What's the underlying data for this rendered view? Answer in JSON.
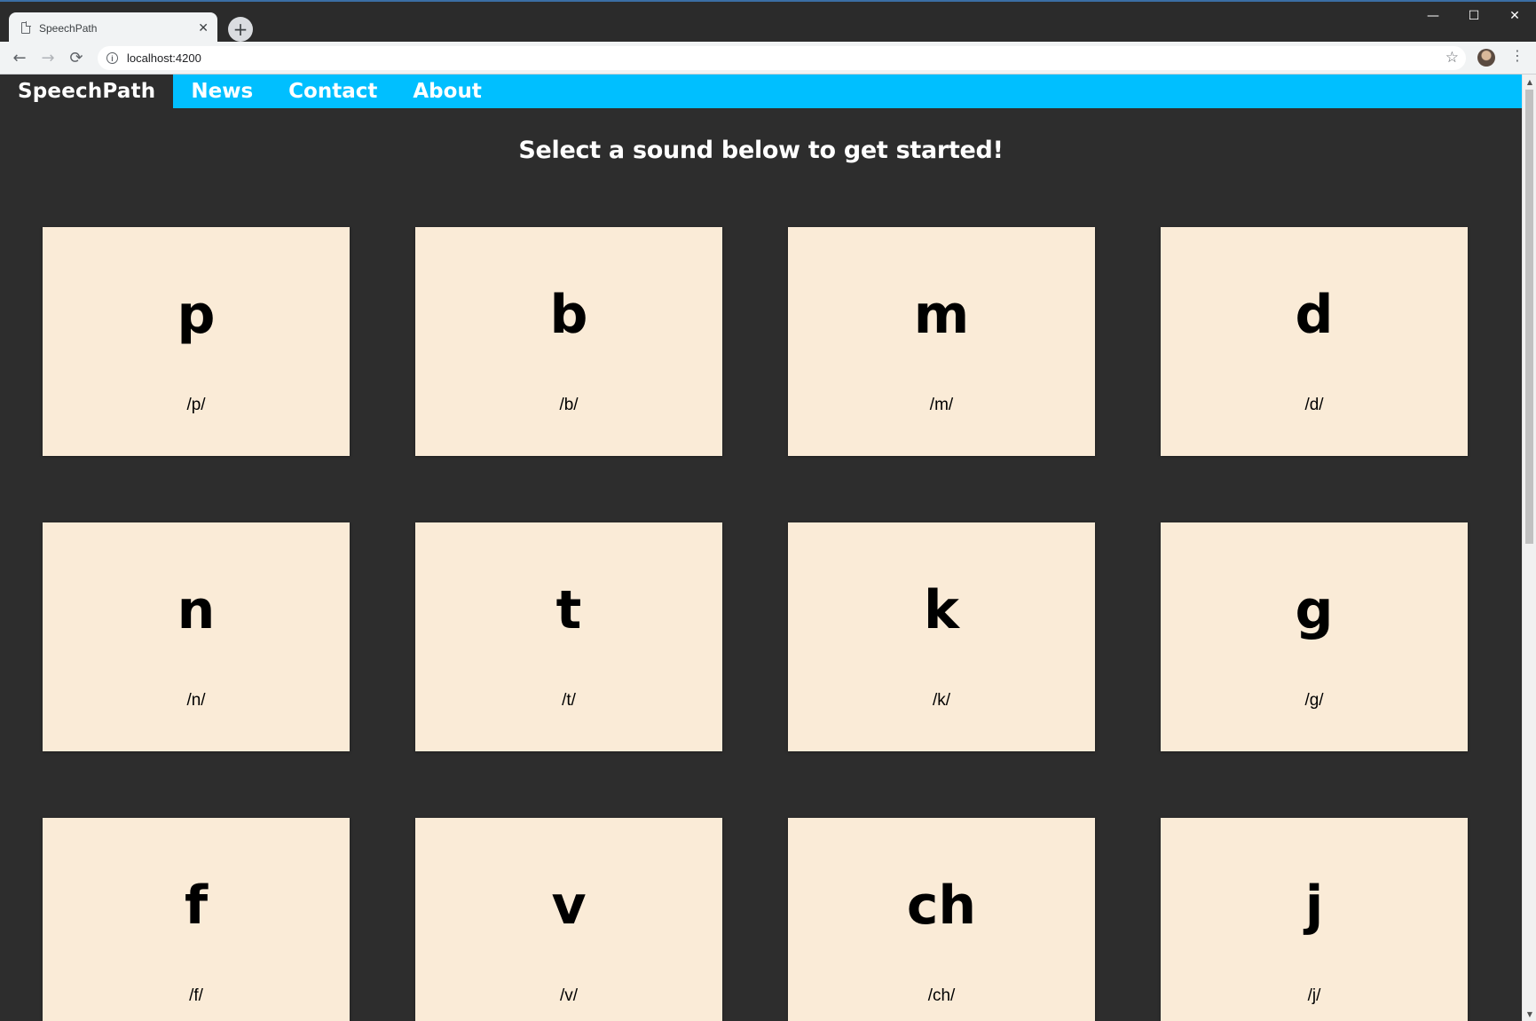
{
  "browser": {
    "tab_title": "SpeechPath",
    "tab_close": "✕",
    "new_tab": "+",
    "url": "localhost:4200",
    "controls": {
      "minimize": "—",
      "maximize": "☐",
      "close": "✕"
    },
    "nav": {
      "back": "←",
      "forward": "→",
      "reload": "⟳"
    },
    "bookmark_icon": "☆",
    "menu_icon": "⋮"
  },
  "site": {
    "brand": "SpeechPath",
    "nav_links": [
      {
        "label": "News"
      },
      {
        "label": "Contact"
      },
      {
        "label": "About"
      }
    ],
    "headline": "Select a sound below to get started!",
    "sounds": [
      {
        "symbol": "p",
        "ipa": "/p/"
      },
      {
        "symbol": "b",
        "ipa": "/b/"
      },
      {
        "symbol": "m",
        "ipa": "/m/"
      },
      {
        "symbol": "d",
        "ipa": "/d/"
      },
      {
        "symbol": "n",
        "ipa": "/n/"
      },
      {
        "symbol": "t",
        "ipa": "/t/"
      },
      {
        "symbol": "k",
        "ipa": "/k/"
      },
      {
        "symbol": "g",
        "ipa": "/g/"
      },
      {
        "symbol": "f",
        "ipa": "/f/"
      },
      {
        "symbol": "v",
        "ipa": "/v/"
      },
      {
        "symbol": "ch",
        "ipa": "/ch/"
      },
      {
        "symbol": "j",
        "ipa": "/j/"
      }
    ]
  },
  "colors": {
    "nav_background": "#00bfff",
    "page_background": "#2d2d2d",
    "card_background": "#faebd7"
  }
}
